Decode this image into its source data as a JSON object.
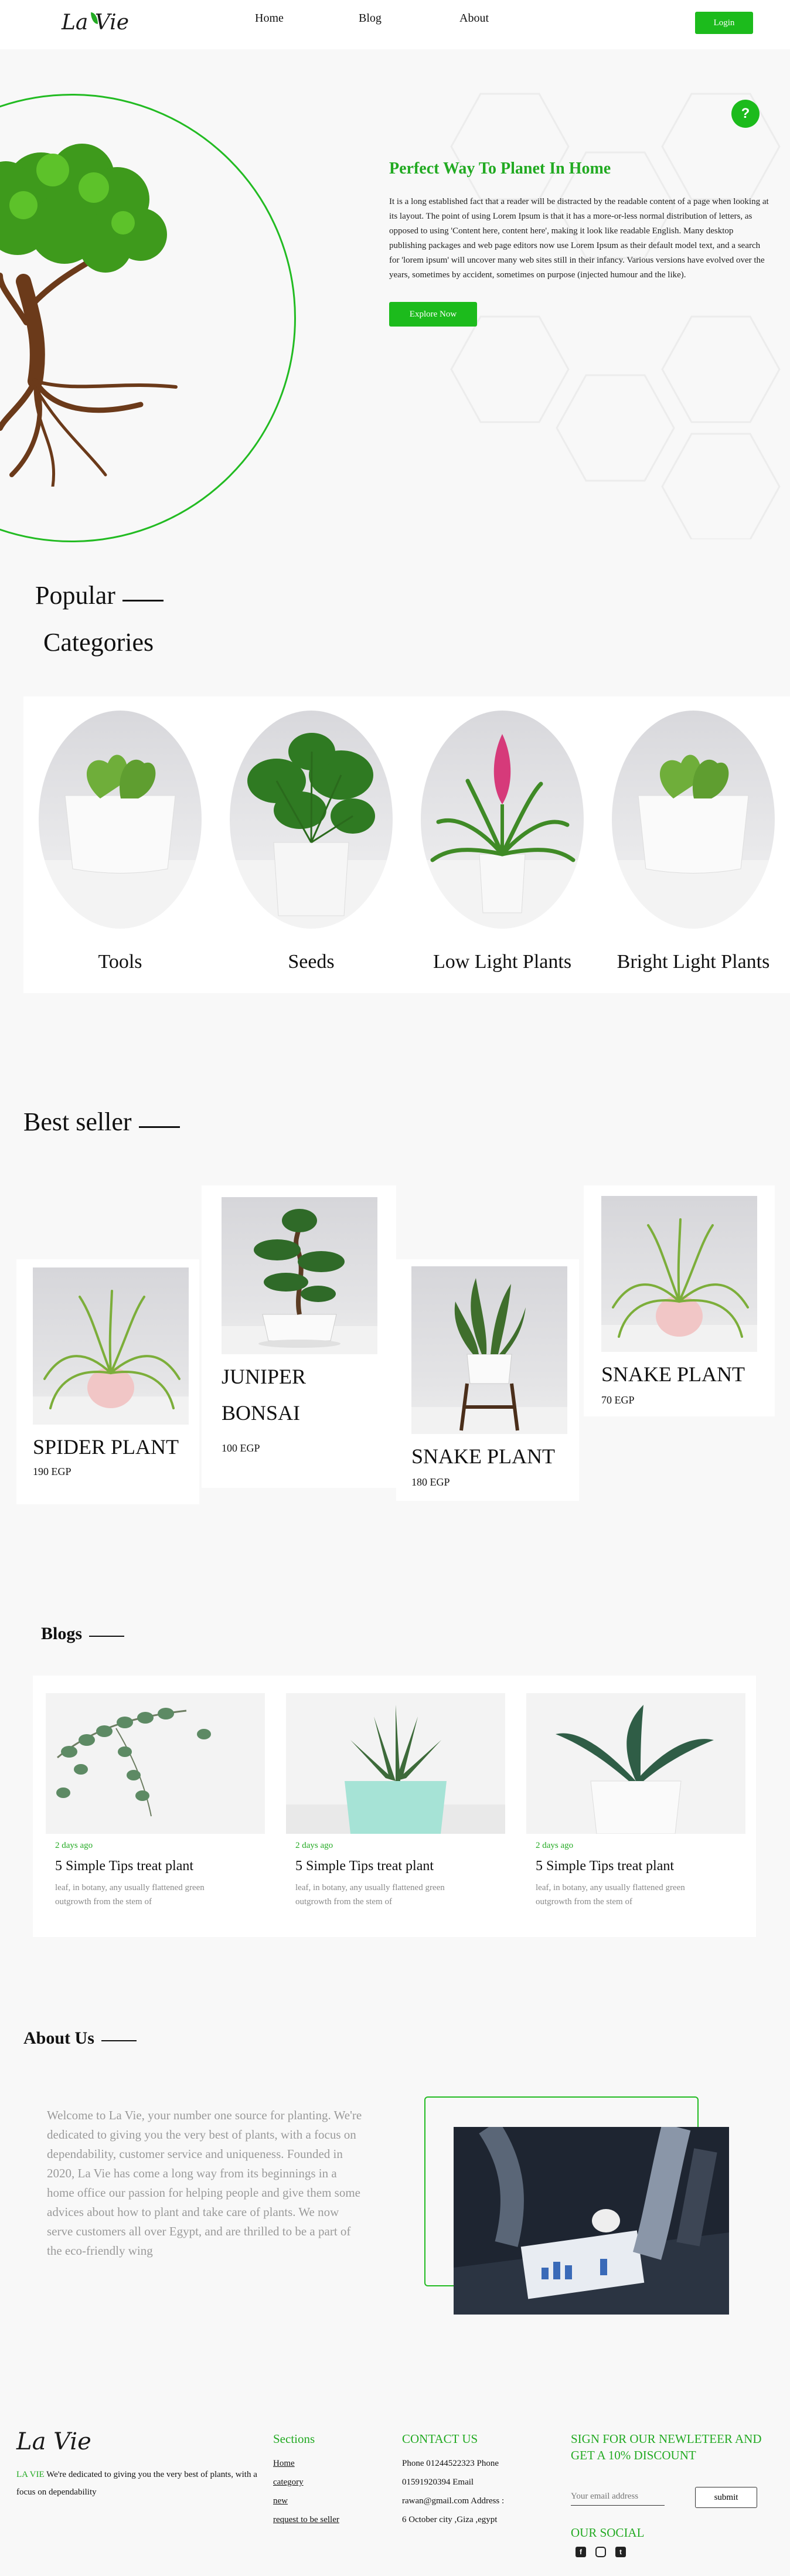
{
  "brand": {
    "logo_text": "La Vie"
  },
  "nav": {
    "items": [
      "Home",
      "Blog",
      "About"
    ],
    "login": "Login"
  },
  "hero": {
    "title": "Perfect Way To Planet In Home",
    "text": "It is a long established fact that a reader will be distracted by the readable content of a page when looking at its layout. The point of using Lorem Ipsum is that it has a more-or-less normal distribution of letters, as opposed to using 'Content here, content here', making it look like readable English. Many desktop publishing packages and web page editors now use Lorem Ipsum as their default model text, and a search for 'lorem ipsum' will uncover many web sites still in their infancy. Various versions have evolved over the years, sometimes by accident, sometimes on purpose (injected humour and the like).",
    "button": "Explore Now",
    "help": "?"
  },
  "categories": {
    "title_line1": "Popular",
    "title_line2": "Categories",
    "items": [
      {
        "label": "Tools",
        "icon": "hoya-heart-plant"
      },
      {
        "label": "Seeds",
        "icon": "monstera-plant"
      },
      {
        "label": "Low Light Plants",
        "icon": "bromeliad-plant"
      },
      {
        "label": "Bright Light Plants",
        "icon": "hoya-heart-plant"
      }
    ]
  },
  "bestseller": {
    "title": "Best seller",
    "items": [
      {
        "name": "SPIDER PLANT",
        "price": "190 EGP"
      },
      {
        "name": "JUNIPER BONSAI",
        "name_line1": "JUNIPER",
        "name_line2": "BONSAI",
        "price": "100 EGP"
      },
      {
        "name": "SNAKE PLANT",
        "price": "180 EGP"
      },
      {
        "name": "SNAKE PLANT",
        "price": "70 EGP"
      }
    ]
  },
  "blogs": {
    "title": "Blogs",
    "items": [
      {
        "date": "2 days ago",
        "title": "5 Simple Tips treat plant",
        "desc": "leaf, in botany, any usually flattened green outgrowth from the stem of"
      },
      {
        "date": "2 days ago",
        "title": "5 Simple Tips treat plant",
        "desc": "leaf, in botany, any usually flattened green outgrowth from the stem of"
      },
      {
        "date": "2 days ago",
        "title": "5 Simple Tips treat plant",
        "desc": "leaf, in botany, any usually flattened green outgrowth from the stem of"
      }
    ]
  },
  "about": {
    "title": "About Us",
    "text": "Welcome to La Vie, your number one source for planting. We're dedicated to giving you the very best of plants, with a focus on dependability, customer service and uniqueness. Founded in 2020, La Vie has come a long way from its beginnings in a home office our passion for helping people and give them some advices about how to plant and take care of plants. We now serve customers all over Egypt, and are thrilled to be a part of the eco-friendly wing"
  },
  "footer": {
    "brand_name": "LA VIE",
    "about_text": " We're dedicated to giving you the very best of plants, with a focus on dependability",
    "sections_title": "Sections",
    "sections": [
      "Home",
      "category",
      "new",
      "request to be seller"
    ],
    "contact_title": "CONTACT US",
    "contact_lines": [
      "Phone 01244522323 Phone",
      "01591920394 Email",
      "rawan@gmail.com Address :",
      "6 October city ,Giza ,egypt"
    ],
    "newsletter_title": "SIGN FOR OUR NEWLETEER AND GET A 10% DISCOUNT",
    "email_placeholder": "Your email address",
    "submit": "submit",
    "social_title": "OUR SOCIAL",
    "socials": [
      "facebook-icon",
      "instagram-icon",
      "twitter-icon"
    ]
  },
  "colors": {
    "accent": "#1cbb1c",
    "text": "#111111",
    "muted": "#9a9a9a"
  }
}
